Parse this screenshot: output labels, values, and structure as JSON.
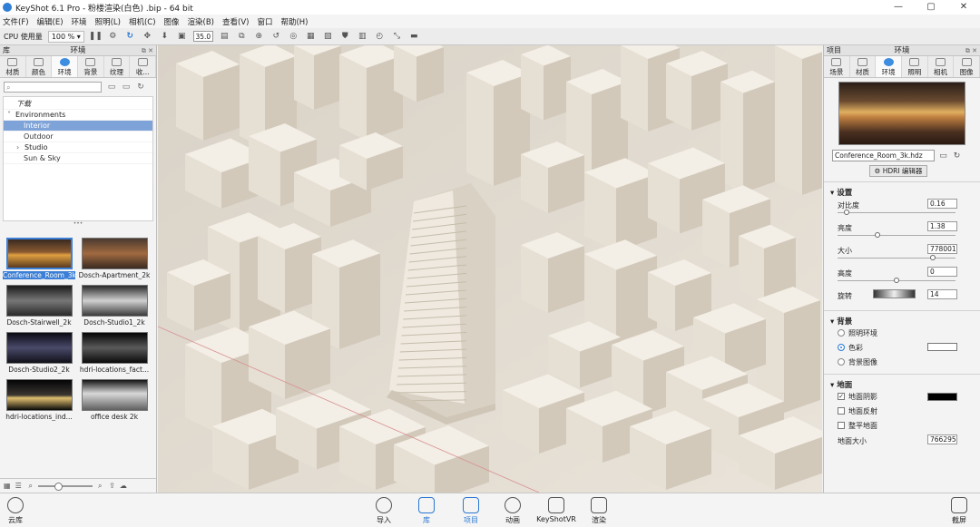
{
  "window": {
    "title": "KeyShot 6.1 Pro - 粉楼渲染(白色) .bip - 64 bit",
    "controls": [
      "—",
      "▢",
      "✕"
    ]
  },
  "menu": [
    "文件(F)",
    "编辑(E)",
    "环境",
    "照明(L)",
    "相机(C)",
    "图像",
    "渲染(B)",
    "查看(V)",
    "窗口",
    "帮助(H)"
  ],
  "toolbar": {
    "cpu_label": "CPU 使用量",
    "cpu_value": "100 % ▾",
    "fov_value": "35.0"
  },
  "left_panel": {
    "title": "环境",
    "left_label": "库",
    "tabs": [
      "材质",
      "颜色",
      "环境",
      "背景",
      "纹理",
      "收..."
    ],
    "active_tab": "环境",
    "search_placeholder": "",
    "tree": {
      "download": "下载",
      "root": "Environments",
      "items": [
        "Interior",
        "Outdoor",
        "Studio",
        "Sun & Sky"
      ]
    },
    "thumbnails": [
      "Conference_Room_3k",
      "Dosch-Apartment_2k",
      "Dosch-Stairwell_2k",
      "Dosch-Studio1_2k",
      "Dosch-Studio2_2k",
      "hdri-locations_fact...",
      "hdri-locations_ind...",
      "office desk 2k"
    ]
  },
  "right_panel": {
    "top_left": "项目",
    "title": "环境",
    "tabs": [
      "场景",
      "材质",
      "环境",
      "照明",
      "相机",
      "图像"
    ],
    "active_tab": "环境",
    "hdri_file": "Conference_Room_3k.hdz",
    "hdri_editor": "HDRI 编辑器",
    "settings_title": "设置",
    "settings": [
      {
        "label": "对比度",
        "value": "0.16",
        "level": 0.06
      },
      {
        "label": "亮度",
        "value": "1.38",
        "level": 0.33
      },
      {
        "label": "大小",
        "value": "778001",
        "level": 0.82
      },
      {
        "label": "高度",
        "value": "0",
        "level": 0.5
      },
      {
        "label": "旋转",
        "value": "14"
      }
    ],
    "background_title": "背景",
    "background_options": [
      "照明环境",
      "色彩",
      "背景图像"
    ],
    "background_selected": "色彩",
    "background_color": "#ffffff",
    "ground_title": "地面",
    "ground_options": [
      {
        "label": "地面阴影",
        "checked": true
      },
      {
        "label": "地面反射",
        "checked": false
      },
      {
        "label": "整平地面",
        "checked": false
      },
      {
        "label": "地面大小",
        "value": "766295"
      }
    ],
    "ground_shadow_color": "#000000"
  },
  "statusbar": {
    "left": "云库",
    "center": [
      "导入",
      "库",
      "项目",
      "动画",
      "KeyShotVR",
      "渲染"
    ],
    "active": [
      "库",
      "项目"
    ],
    "right": "截屏"
  },
  "colors": {
    "accent": "#2f7fd6",
    "tree_selected": "#7ea3d8",
    "viewport_bg": "#e3ddd4"
  }
}
